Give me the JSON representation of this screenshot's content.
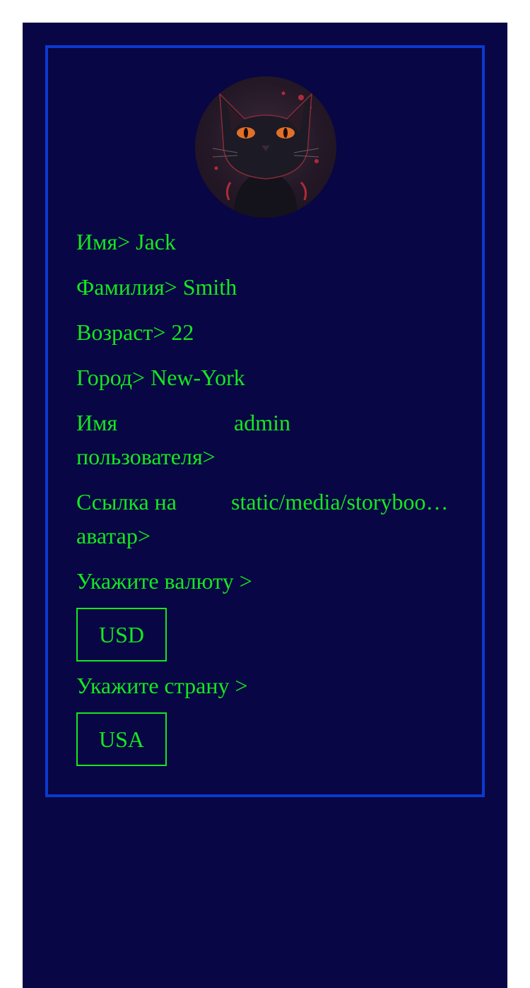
{
  "profile": {
    "first_name_label": "Имя>",
    "first_name": "Jack",
    "last_name_label": "Фамилия>",
    "last_name": "Smith",
    "age_label": "Возраст>",
    "age": "22",
    "city_label": "Город>",
    "city": "New-York",
    "username_label_line1": "Имя",
    "username_label_line2": "пользователя>",
    "username": "admin",
    "avatar_link_label_line1": "Ссылка на",
    "avatar_link_label_line2": "аватар>",
    "avatar_link": "static/media/storyboo…"
  },
  "currency": {
    "label": "Укажите валюту >",
    "selected": "USD"
  },
  "country": {
    "label": "Укажите страну >",
    "selected": "USA"
  },
  "avatar": {
    "icon": "black-cat-avatar"
  },
  "colors": {
    "background": "#080644",
    "border": "#0a3ad0",
    "text": "#14e81f"
  }
}
